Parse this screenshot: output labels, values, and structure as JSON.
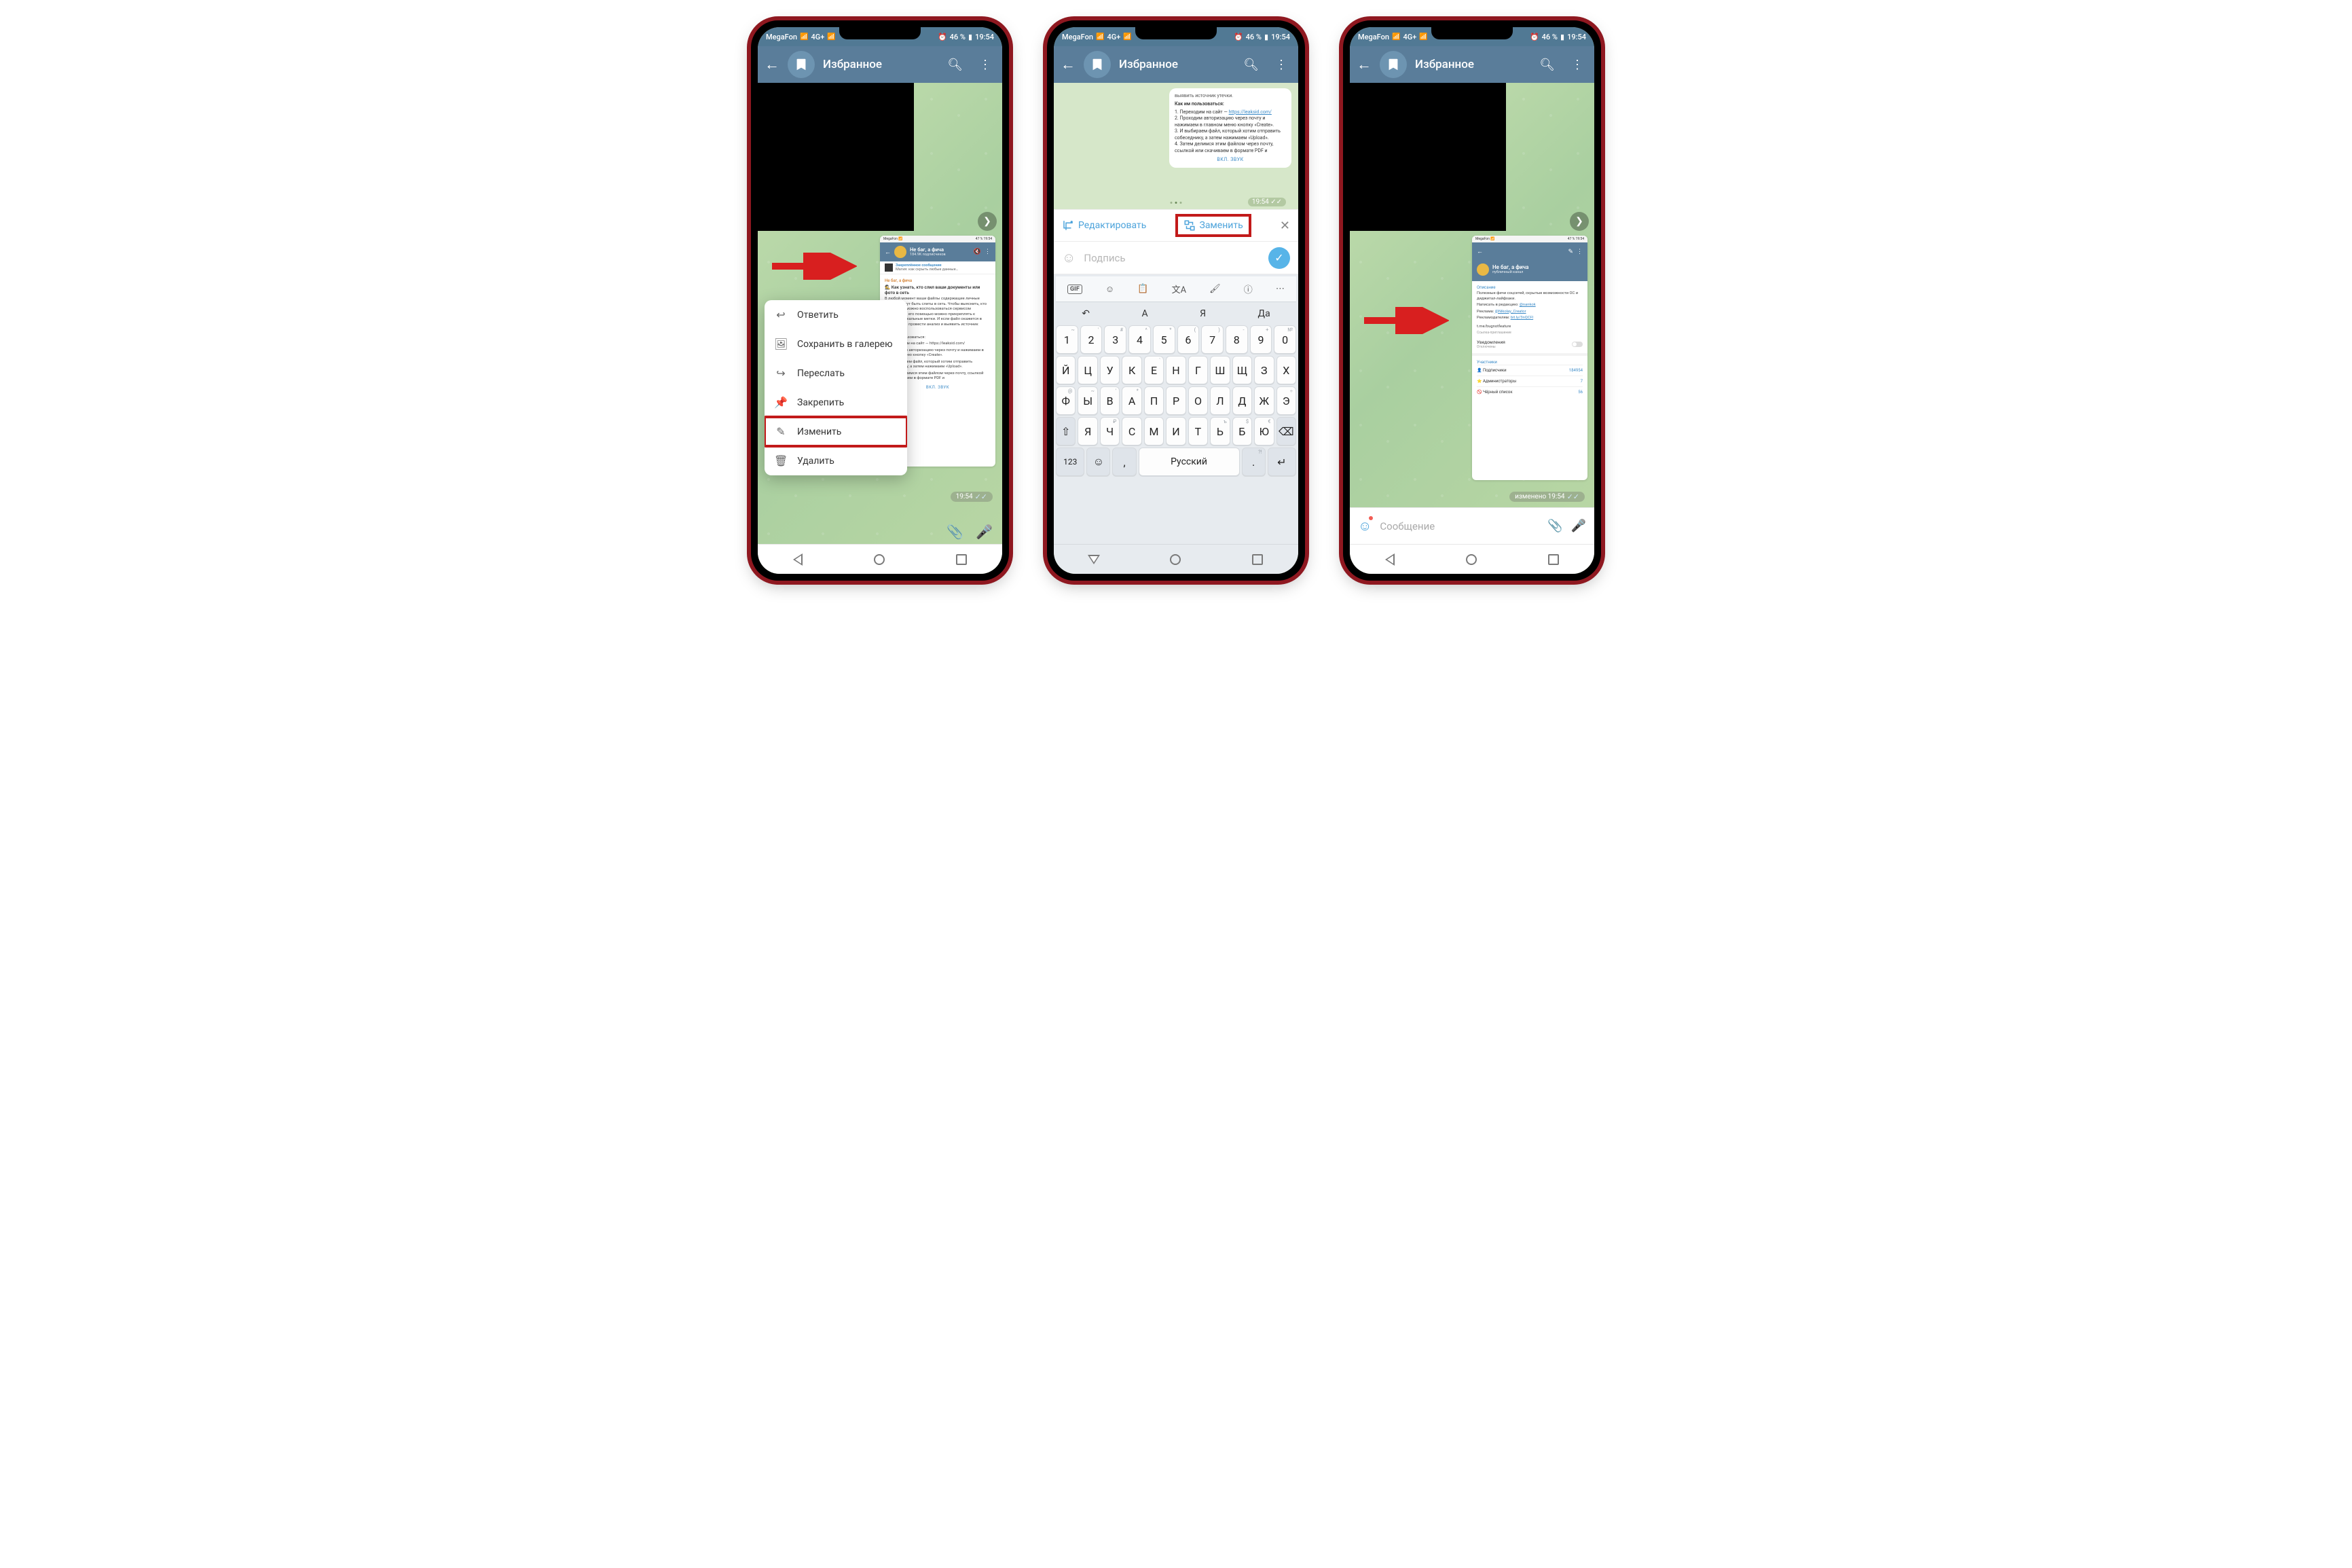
{
  "status": {
    "carrier": "MegaFon",
    "net": "4G+",
    "battery": "46 %",
    "time": "19:54"
  },
  "header": {
    "title": "Избранное"
  },
  "ctx": {
    "reply": "Ответить",
    "save": "Сохранить в галерею",
    "forward": "Переслать",
    "pin": "Закрепить",
    "edit": "Изменить",
    "delete": "Удалить"
  },
  "mini1": {
    "status_time": "19:54",
    "status_bat": "47 %",
    "chan_title": "Не баг, а фича",
    "chan_sub": "184.9K подписчиков",
    "pinned_label": "Закреплённое сообщение",
    "pinned_text": "Магия: как скрыть любые данные…",
    "src": "Не баг, а фича",
    "post_title": "🕵 Как узнать, кто слил ваши документы или фото в сеть",
    "l1": "В любой момент ваши файлы содержащие личные данные могут быть слиты в сеть. Чтобы выяснить, кто это сделал можно воспользоваться сервисом «LeakSID». С его помощью можно прикреплять к файлам уникальные метки. И если файл окажется в интернете — провести анализ и выявить источник утечки.",
    "l2": "Как им пользоваться:",
    "l3": "1. Переходим на сайт — https://leaksid.com/",
    "l4": "2. Проходим авторизацию через почту и нажимаем в главном меню кнопку «Create».",
    "l5": "3. И выбираем файл, который хотим отправить собеседнику, а затем нажимаем «Upload».",
    "l6": "4. Затем делимся этим файлом через почту, ссылкой или скачиваем в формате PDF и",
    "sound": "ВКЛ. ЗВУК"
  },
  "badge": {
    "time": "19:54",
    "edited": "изменено 19:54"
  },
  "p2": {
    "prev_title": "Как им пользоваться:",
    "prev_1": "1. Переходим на сайт —",
    "prev_link": "https://leaksid.com/",
    "prev_2": "2. Проходим авторизацию через почту и нажимаем в главном меню кнопку «Create».",
    "prev_3": "3. И выбираем файл, который хотим отправить собеседнику, а затем нажимаем «Upload».",
    "prev_4": "4. Затем делимся этим файлом через почту, ссылкой или скачиваем в формате PDF и",
    "sound": "ВКЛ. ЗВУК",
    "edit": "Редактировать",
    "replace": "Заменить",
    "caption": "Подпись",
    "sugg1": "А",
    "sugg2": "Я",
    "sugg3": "Да",
    "space": "Русский",
    "numkey": "123"
  },
  "mini3": {
    "status_time": "19:54",
    "status_bat": "47 %",
    "chan_title": "Не баг, а фича",
    "chan_sub": "публичный канал",
    "sec_desc": "Описание",
    "desc1": "Полезные фичи соцсетей, скрытые возможности ОС и диджитал-лайфхаки.",
    "desc2_pre": "Написать в редакцию: ",
    "desc2_link": "@nankok",
    "desc3_pre": "Реклама: ",
    "desc3_link": "@Nikolay_Creator",
    "desc4_pre": "Рекламодателям: ",
    "desc4_link": "bit.ly/3nQCFl",
    "desc5": "t.me/bugnotfeature",
    "desc5_sub": "Ссылка-приглашение",
    "notif": "Уведомления",
    "notif_sub": "Отключены",
    "sec_members": "Участники",
    "row1": "Подписчики",
    "row1v": "184954",
    "row2": "Администраторы",
    "row2v": "7",
    "row3": "Чёрный список",
    "row3v": "56"
  },
  "input": {
    "placeholder": "Сообщение"
  },
  "kbd_rows": {
    "nums": [
      "1",
      "2",
      "3",
      "4",
      "5",
      "6",
      "7",
      "8",
      "9",
      "0"
    ],
    "nums_sup": [
      "~",
      "'",
      "#",
      "^",
      "*",
      "(",
      ")",
      "-",
      "+",
      "№"
    ],
    "r1": [
      "Й",
      "Ц",
      "У",
      "К",
      "Е",
      "Н",
      "Г",
      "Ш",
      "Щ",
      "З",
      "Х"
    ],
    "r1_sup": [
      "",
      "",
      "",
      "",
      "`",
      "",
      "",
      "",
      "",
      "",
      ""
    ],
    "r2": [
      "Ф",
      "Ы",
      "В",
      "А",
      "П",
      "Р",
      "О",
      "Л",
      "Д",
      "Ж",
      "Э"
    ],
    "r2_sup": [
      "@",
      "~",
      "'",
      "*",
      "",
      "",
      "",
      "",
      "",
      "",
      "÷"
    ],
    "r3": [
      "Я",
      "Ч",
      "С",
      "М",
      "И",
      "Т",
      "Ь",
      "Б",
      "Ю"
    ],
    "r3_sup": [
      "",
      "₽",
      "",
      "",
      "",
      "",
      "ъ",
      "$",
      "€"
    ]
  }
}
